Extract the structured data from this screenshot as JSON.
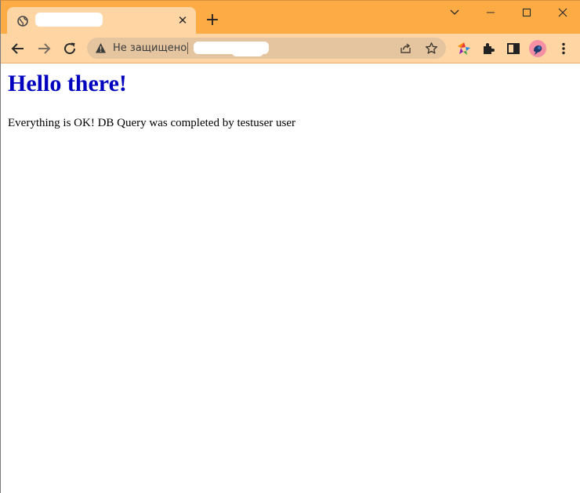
{
  "tab": {
    "title": "",
    "close_glyph": "✕"
  },
  "new_tab_glyph": "+",
  "window_controls": {
    "tab_search": "tab-search-chevron-icon",
    "minimize": "minimize-icon",
    "maximize": "maximize-icon",
    "close": "close-icon"
  },
  "toolbar": {
    "back": "back-arrow-icon",
    "forward": "forward-arrow-icon",
    "reload": "reload-icon",
    "extensions": [
      "colorful-star-extension-icon",
      "puzzle-extensions-icon",
      "side-panel-icon",
      "more-menu-icon"
    ]
  },
  "omnibox": {
    "security_label": "Не защищено",
    "url": ""
  },
  "content": {
    "heading": "Hello there!",
    "message": "Everything is OK! DB Query was completed by testuser user"
  },
  "colors": {
    "titlebar": "#fdac45",
    "toolbar": "#fed5a3",
    "omnibox": "#e4c5a0",
    "heading": "#0000bf",
    "avatar": "#f58fa4"
  }
}
